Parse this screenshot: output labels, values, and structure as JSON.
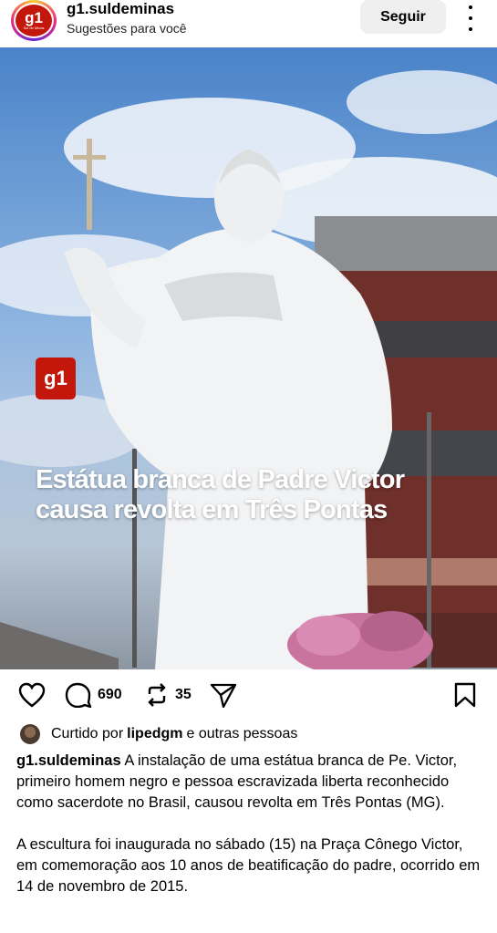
{
  "header": {
    "avatar_text": "g1",
    "avatar_subtext": "Sul de Minas",
    "username": "g1.suldeminas",
    "subtitle": "Sugestões para você",
    "follow_label": "Seguir"
  },
  "media": {
    "logo_text": "g1",
    "headline": "Estátua branca de Padre Victor causa revolta em Três Pontas"
  },
  "actions": {
    "comments_count": "690",
    "reposts_count": "35"
  },
  "likes": {
    "prefix": "Curtido por",
    "user": "lipedgm",
    "suffix": "e outras pessoas"
  },
  "caption": {
    "username": "g1.suldeminas",
    "paragraph1": "A instalação de uma estátua branca de Pe. Victor, primeiro homem negro e pessoa escravizada liberta reconhecido como sacerdote no Brasil, causou revolta em Três Pontas (MG).",
    "paragraph2": "A escultura foi inaugurada no sábado (15) na Praça Cônego Victor, em comemoração aos 10 anos de beatificação do padre, ocorrido em 14 de novembro de 2015."
  },
  "colors": {
    "brand_red": "#c4170c",
    "follow_bg": "#efefef"
  }
}
